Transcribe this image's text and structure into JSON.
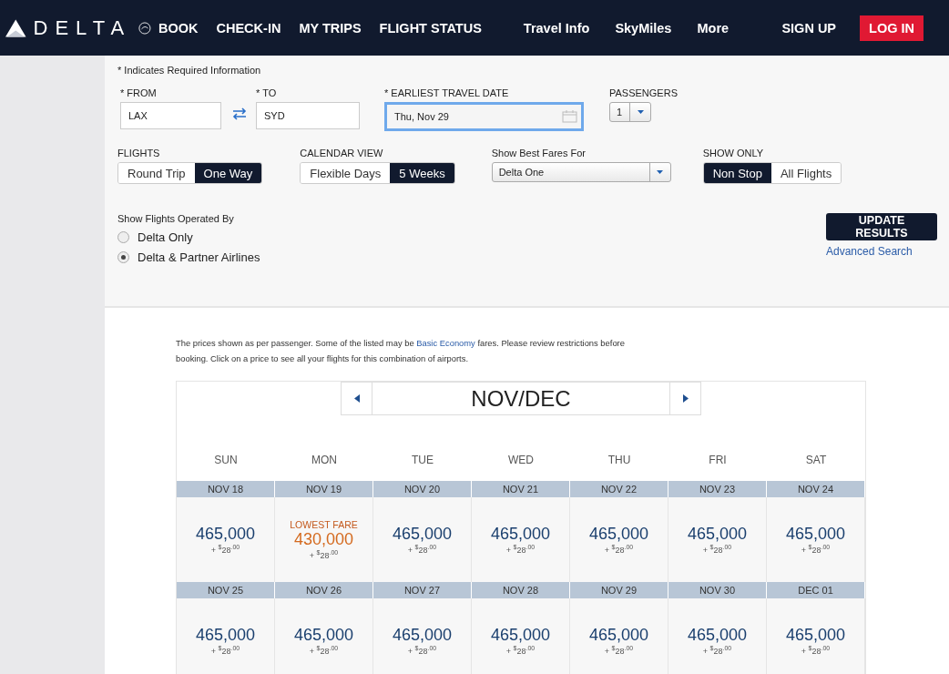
{
  "header": {
    "logo_text": "DELTA",
    "nav": [
      "BOOK",
      "CHECK-IN",
      "MY TRIPS",
      "FLIGHT STATUS"
    ],
    "secondary_nav": [
      "Travel Info",
      "SkyMiles",
      "More"
    ],
    "sign_up": "SIGN UP",
    "log_in": "LOG IN"
  },
  "search_form": {
    "required_note": "* Indicates Required Information",
    "from": {
      "label": "* FROM",
      "value": "LAX"
    },
    "to": {
      "label": "* TO",
      "value": "SYD"
    },
    "travel_date": {
      "label": "* EARLIEST TRAVEL DATE",
      "value": "Thu, Nov 29"
    },
    "passengers": {
      "label": "PASSENGERS",
      "value": "1"
    },
    "flights": {
      "label": "FLIGHTS",
      "options": [
        {
          "label": "Round Trip",
          "selected": false
        },
        {
          "label": "One Way",
          "selected": true
        }
      ]
    },
    "calendar_view": {
      "label": "CALENDAR VIEW",
      "options": [
        {
          "label": "Flexible Days",
          "selected": false
        },
        {
          "label": "5 Weeks",
          "selected": true
        }
      ]
    },
    "best_fares": {
      "label": "Show Best Fares For",
      "value": "Delta One"
    },
    "show_only": {
      "label": "SHOW ONLY",
      "options": [
        {
          "label": "Non Stop",
          "selected": true
        },
        {
          "label": "All Flights",
          "selected": false
        }
      ]
    },
    "operated_by": {
      "label": "Show Flights Operated By",
      "options": [
        {
          "label": "Delta Only",
          "selected": false
        },
        {
          "label": "Delta & Partner Airlines",
          "selected": true
        }
      ]
    },
    "update_button": "UPDATE RESULTS",
    "advanced_search": "Advanced Search"
  },
  "notice": {
    "before": "The prices shown as per passenger. Some of the listed may be ",
    "link": "Basic Economy",
    "after": " fares. Please review restrictions before booking. Click on a price to see all your flights for this combination of airports."
  },
  "calendar": {
    "month": "NOV/DEC",
    "weekdays": [
      "SUN",
      "MON",
      "TUE",
      "WED",
      "THU",
      "FRI",
      "SAT"
    ],
    "weeks": [
      {
        "days": [
          {
            "date": "NOV 18",
            "points": "465,000",
            "fee": "+ $^{$}$28$^{.00}$",
            "lowest": false
          },
          {
            "date": "NOV 19",
            "badge": "LOWEST FARE",
            "points": "430,000",
            "fee": "+ $^{$}$28$^{.00}$",
            "lowest": true
          },
          {
            "date": "NOV 20",
            "points": "465,000",
            "fee": "+ $^{$}$28$^{.00}$",
            "lowest": false
          },
          {
            "date": "NOV 21",
            "points": "465,000",
            "fee": "+ $^{$}$28$^{.00}$",
            "lowest": false
          },
          {
            "date": "NOV 22",
            "points": "465,000",
            "fee": "+ $^{$}$28$^{.00}$",
            "lowest": false
          },
          {
            "date": "NOV 23",
            "points": "465,000",
            "fee": "+ $^{$}$28$^{.00}$",
            "lowest": false
          },
          {
            "date": "NOV 24",
            "points": "465,000",
            "fee": "+ $^{$}$28$^{.00}$",
            "lowest": false
          }
        ]
      },
      {
        "days": [
          {
            "date": "NOV 25",
            "points": "465,000",
            "fee": "+ $^{$}$28$^{.00}$",
            "lowest": false
          },
          {
            "date": "NOV 26",
            "points": "465,000",
            "fee": "+ $^{$}$28$^{.00}$",
            "lowest": false
          },
          {
            "date": "NOV 27",
            "points": "465,000",
            "fee": "+ $^{$}$28$^{.00}$",
            "lowest": false
          },
          {
            "date": "NOV 28",
            "points": "465,000",
            "fee": "+ $^{$}$28$^{.00}$",
            "lowest": false
          },
          {
            "date": "NOV 29",
            "points": "465,000",
            "fee": "+ $^{$}$28$^{.00}$",
            "lowest": false
          },
          {
            "date": "NOV 30",
            "points": "465,000",
            "fee": "+ $^{$}$28$^{.00}$",
            "lowest": false
          },
          {
            "date": "DEC 01",
            "points": "465,000",
            "fee": "+ $^{$}$28$^{.00}$",
            "lowest": false
          }
        ]
      }
    ]
  }
}
